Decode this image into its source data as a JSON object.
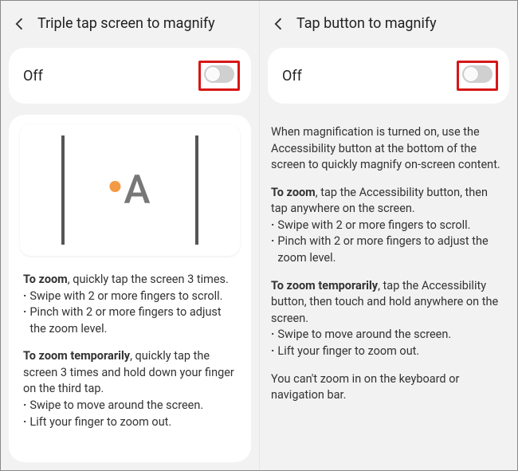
{
  "left": {
    "title": "Triple tap screen to magnify",
    "toggle_label": "Off",
    "p1_lead": "To zoom",
    "p1_rest": ", quickly tap the screen 3 times.",
    "p1_b1": "Swipe with 2 or more fingers to scroll.",
    "p1_b2": "Pinch with 2 or more fingers to adjust the zoom level.",
    "p2_lead": "To zoom temporarily",
    "p2_rest": ", quickly tap the screen 3 times and hold down your finger on the third tap.",
    "p2_b1": "Swipe to move around the screen.",
    "p2_b2": "Lift your finger to zoom out."
  },
  "right": {
    "title": "Tap button to magnify",
    "toggle_label": "Off",
    "intro": "When magnification is turned on, use the Accessibility button at the bottom of the screen to quickly magnify on-screen content.",
    "p1_lead": "To zoom",
    "p1_rest": ", tap the Accessibility button, then tap anywhere on the screen.",
    "p1_b1": "Swipe with 2 or more fingers to scroll.",
    "p1_b2": "Pinch with 2 or more fingers to adjust the zoom level.",
    "p2_lead": "To zoom temporarily",
    "p2_rest": ", tap the Accessibility button, then touch and hold anywhere on the screen.",
    "p2_b1": "Swipe to move around the screen.",
    "p2_b2": "Lift your finger to zoom out.",
    "footer": "You can't zoom in on the keyboard or navigation bar."
  }
}
